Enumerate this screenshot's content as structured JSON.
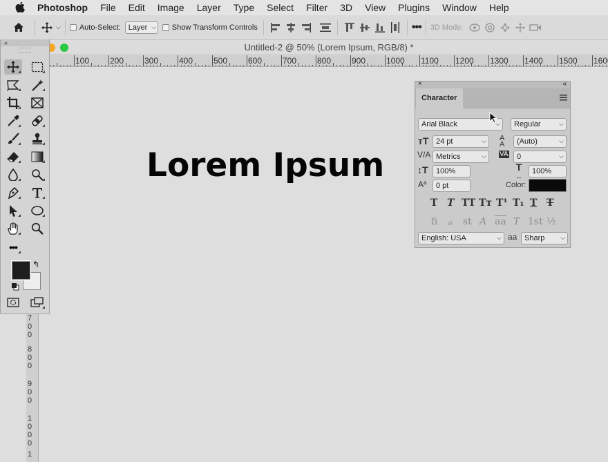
{
  "menubar": {
    "app": "Photoshop",
    "items": [
      "File",
      "Edit",
      "Image",
      "Layer",
      "Type",
      "Select",
      "Filter",
      "3D",
      "View",
      "Plugins",
      "Window",
      "Help"
    ]
  },
  "options": {
    "auto_select_label": "Auto-Select:",
    "auto_select_value": "Layer",
    "show_transform_label": "Show Transform Controls",
    "mode3d_label": "3D Mode:"
  },
  "document": {
    "title": "Untitled-2 @ 50% (Lorem Ipsum, RGB/8) *",
    "canvas_text": "Lorem Ipsum"
  },
  "ruler": {
    "h_labels": [
      "100",
      "200",
      "300",
      "400",
      "500",
      "600",
      "700",
      "800",
      "900",
      "1000",
      "1100",
      "1200",
      "1300",
      "1400",
      "1500",
      "1600"
    ],
    "v_labels": [
      "7",
      "0",
      "0",
      "8",
      "0",
      "0",
      "9",
      "0",
      "0",
      "1",
      "0",
      "0",
      "0",
      "1",
      "1"
    ]
  },
  "character": {
    "tab": "Character",
    "font_family": "Arial Black",
    "font_style": "Regular",
    "font_size": "24 pt",
    "leading": "(Auto)",
    "kerning": "Metrics",
    "tracking": "0",
    "vertical_scale": "100%",
    "horizontal_scale": "100%",
    "baseline_shift": "0 pt",
    "color_label": "Color:",
    "color_value": "#0a0a0a",
    "language": "English: USA",
    "antialias_label": "aa",
    "antialias": "Sharp",
    "style_buttons": [
      "T",
      "T",
      "TT",
      "Tт",
      "T¹",
      "T₁",
      "T",
      "T"
    ],
    "opentype_buttons": [
      "fi",
      "ℴ",
      "st",
      "A",
      "aa",
      "T",
      "1st",
      "½"
    ]
  },
  "colors": {
    "foreground": "#1e1e1e",
    "background": "#ededed"
  }
}
